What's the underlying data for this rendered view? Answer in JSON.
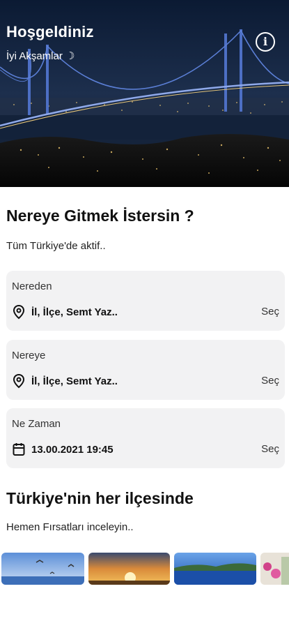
{
  "header": {
    "title": "Hoşgeldiniz",
    "greeting": "İyi Akşamlar ☽",
    "info_icon": "info-circle-icon"
  },
  "search": {
    "title": "Nereye Gitmek İstersin ?",
    "subtitle": "Tüm Türkiye'de aktif..",
    "fields": [
      {
        "label": "Nereden",
        "icon": "location-pin-icon",
        "value": "İl, İlçe, Semt Yaz..",
        "action": "Seç"
      },
      {
        "label": "Nereye",
        "icon": "location-pin-icon",
        "value": "İl, İlçe, Semt Yaz..",
        "action": "Seç"
      },
      {
        "label": "Ne Zaman",
        "icon": "calendar-icon",
        "value": "13.00.2021 19:45",
        "action": "Seç"
      }
    ]
  },
  "deals": {
    "title": "Türkiye'nin her ilçesinde",
    "subtitle": "Hemen Fırsatları inceleyin.."
  },
  "colors": {
    "card_bg": "#f2f2f3",
    "bridge_light": "#5b7fd6"
  }
}
